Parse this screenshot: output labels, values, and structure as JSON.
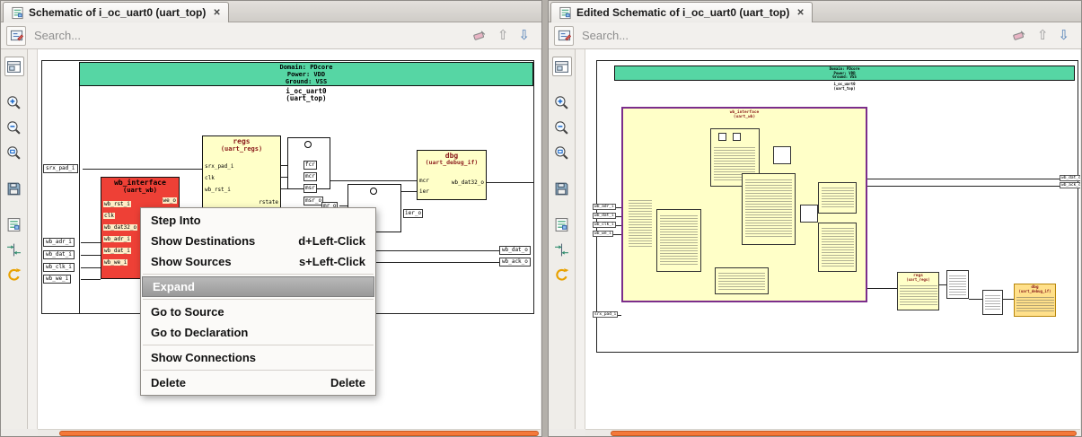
{
  "icons": {
    "close": "✕",
    "up_arrow": "⇧",
    "down_arrow": "⇩"
  },
  "panels": {
    "left": {
      "tab_title": "Schematic of i_oc_uart0 (uart_top)",
      "search_placeholder": "Search..."
    },
    "right": {
      "tab_title": "Edited Schematic of i_oc_uart0 (uart_top)",
      "search_placeholder": "Search..."
    }
  },
  "schematic": {
    "header": {
      "domain": "Domain: PDcore",
      "power": "Power: VDD",
      "ground": "Ground: VSS",
      "instance": "i_oc_uart0",
      "module": "(uart_top)"
    },
    "regs": {
      "title": "regs",
      "subtitle": "(uart_regs)",
      "pins_left": [
        "srx_pad_i",
        "clk",
        "wb_rst_i"
      ],
      "pin_bottom": "rstate"
    },
    "dbg": {
      "title": "dbg",
      "subtitle": "(uart_debug_if)",
      "pins_left": [
        "mcr",
        "ier"
      ],
      "pin_right": "wb_dat32_o"
    },
    "wb_interface": {
      "title": "wb_interface",
      "subtitle": "(uart_wb)",
      "pins_left": [
        "wb_rst_i",
        "clk",
        "wb_dat32_o",
        "wb_adr_i",
        "wb_dat_i",
        "wb_we_i"
      ],
      "pin_right": "we_o"
    },
    "net_labels": [
      "fcr",
      "mcr",
      "msr",
      "msr_o",
      "mr_o",
      "ier_o"
    ],
    "ports_left": [
      "srx_pad_i",
      "wb_adr_i",
      "wb_dat_i",
      "wb_clk_i",
      "wb_we_i"
    ],
    "ports_right": [
      "wb_dat_o",
      "wb_ack_o"
    ]
  },
  "edited": {
    "header": {
      "domain": "Domain: PDcore",
      "power": "Power: VDD",
      "ground": "Ground: VSS",
      "instance": "i_oc_uart0",
      "module": "(uart_top)"
    },
    "wb_interface": {
      "title": "wb_interface",
      "subtitle": "(uart_wb)"
    },
    "regs": {
      "title": "regs",
      "subtitle": "(uart_regs)"
    },
    "dbg": {
      "title": "dbg",
      "subtitle": "(uart_debug_if)"
    },
    "ports_left": [
      "wb_adr_i",
      "wb_dat_i",
      "wb_clk_i",
      "wb_we_i",
      "srx_pad_i"
    ],
    "ports_right": [
      "wb_dat_o",
      "wb_ack_o"
    ]
  },
  "context_menu": {
    "highlighted": "Expand",
    "items": [
      {
        "label": "Step Into",
        "shortcut": ""
      },
      {
        "label": "Show Destinations",
        "shortcut": "d+Left-Click"
      },
      {
        "label": "Show Sources",
        "shortcut": "s+Left-Click"
      },
      {
        "label": "Expand",
        "shortcut": ""
      },
      {
        "label": "Go to Source",
        "shortcut": ""
      },
      {
        "label": "Go to Declaration",
        "shortcut": ""
      },
      {
        "label": "Show Connections",
        "shortcut": ""
      },
      {
        "label": "Delete",
        "shortcut": "Delete"
      }
    ]
  },
  "colors": {
    "domain_green": "#56d6a4",
    "block_yellow": "#ffffc8",
    "selected_red": "#ee4036",
    "expanded_purple": "#7b2d8b",
    "dbg_highlight": "#ffe08a",
    "scrollbar_orange": "#f4793a"
  }
}
